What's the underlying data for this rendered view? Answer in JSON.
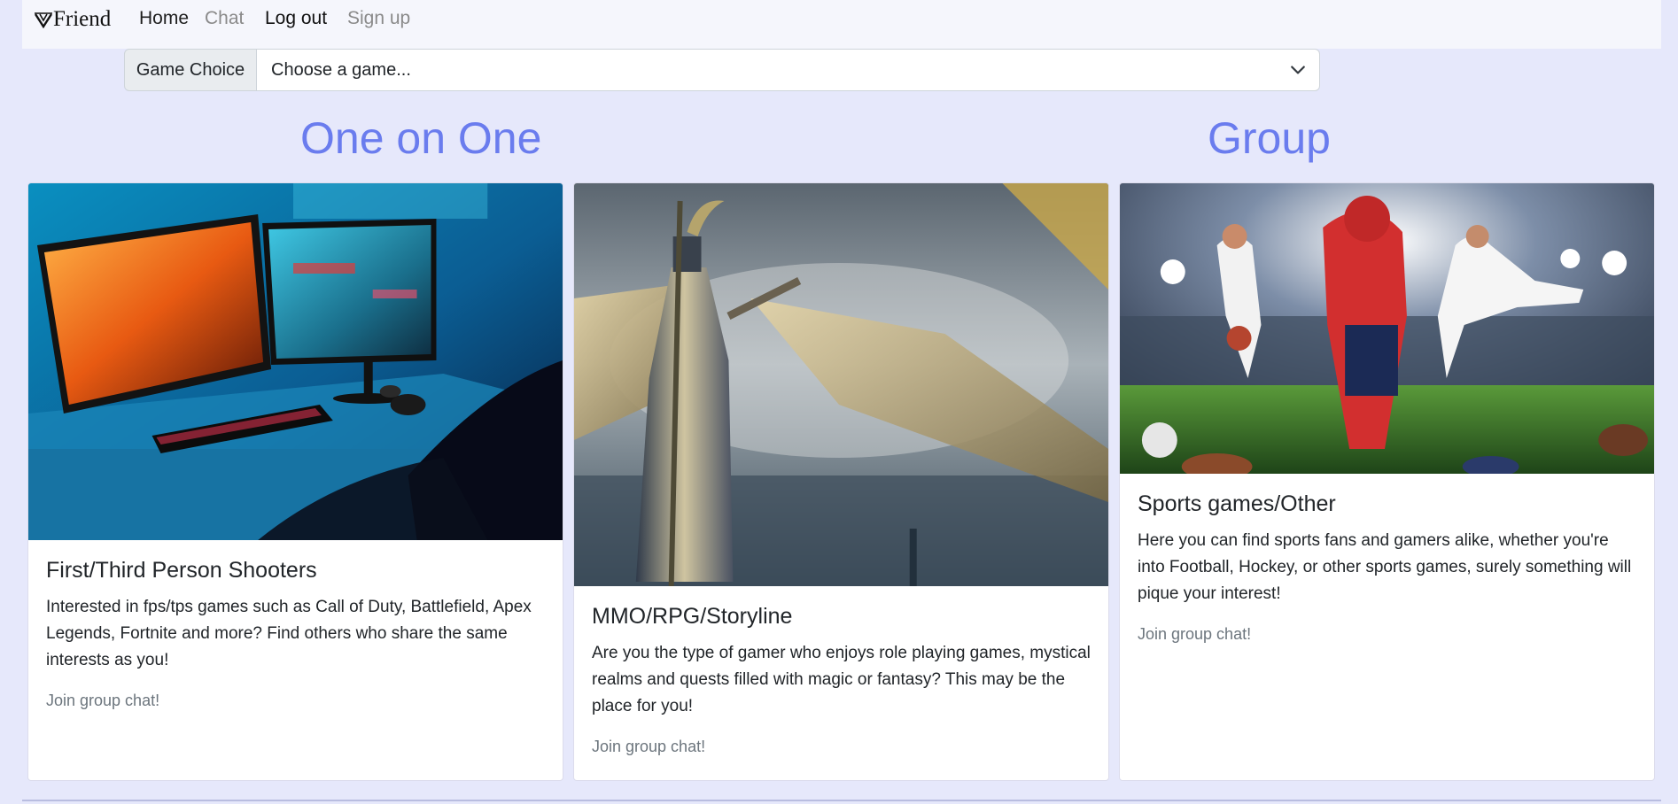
{
  "navbar": {
    "brand": "Friend",
    "links": {
      "home": "Home",
      "chat": "Chat",
      "logout": "Log out",
      "signup": "Sign up"
    }
  },
  "game_choice": {
    "label": "Game Choice",
    "selected": "Choose a game..."
  },
  "headings": {
    "one_on_one": "One on One",
    "group": "Group"
  },
  "cards": [
    {
      "title": "First/Third Person Shooters",
      "text": "Interested in fps/tps games such as Call of Duty, Battlefield, Apex Legends, Fortnite and more? Find others who share the same interests as you!",
      "link": "Join group chat!"
    },
    {
      "title": "MMO/RPG/Storyline",
      "text": "Are you the type of gamer who enjoys role playing games, mystical realms and quests filled with magic or fantasy? This may be the place for you!",
      "link": "Join group chat!"
    },
    {
      "title": "Sports games/Other",
      "text": "Here you can find sports fans and gamers alike, whether you're into Football, Hockey, or other sports games, surely something will pique your interest!",
      "link": "Join group chat!"
    }
  ],
  "colors": {
    "page_background": "#e6e8fb",
    "heading": "#6a7cee",
    "muted_link": "#6c757d"
  }
}
